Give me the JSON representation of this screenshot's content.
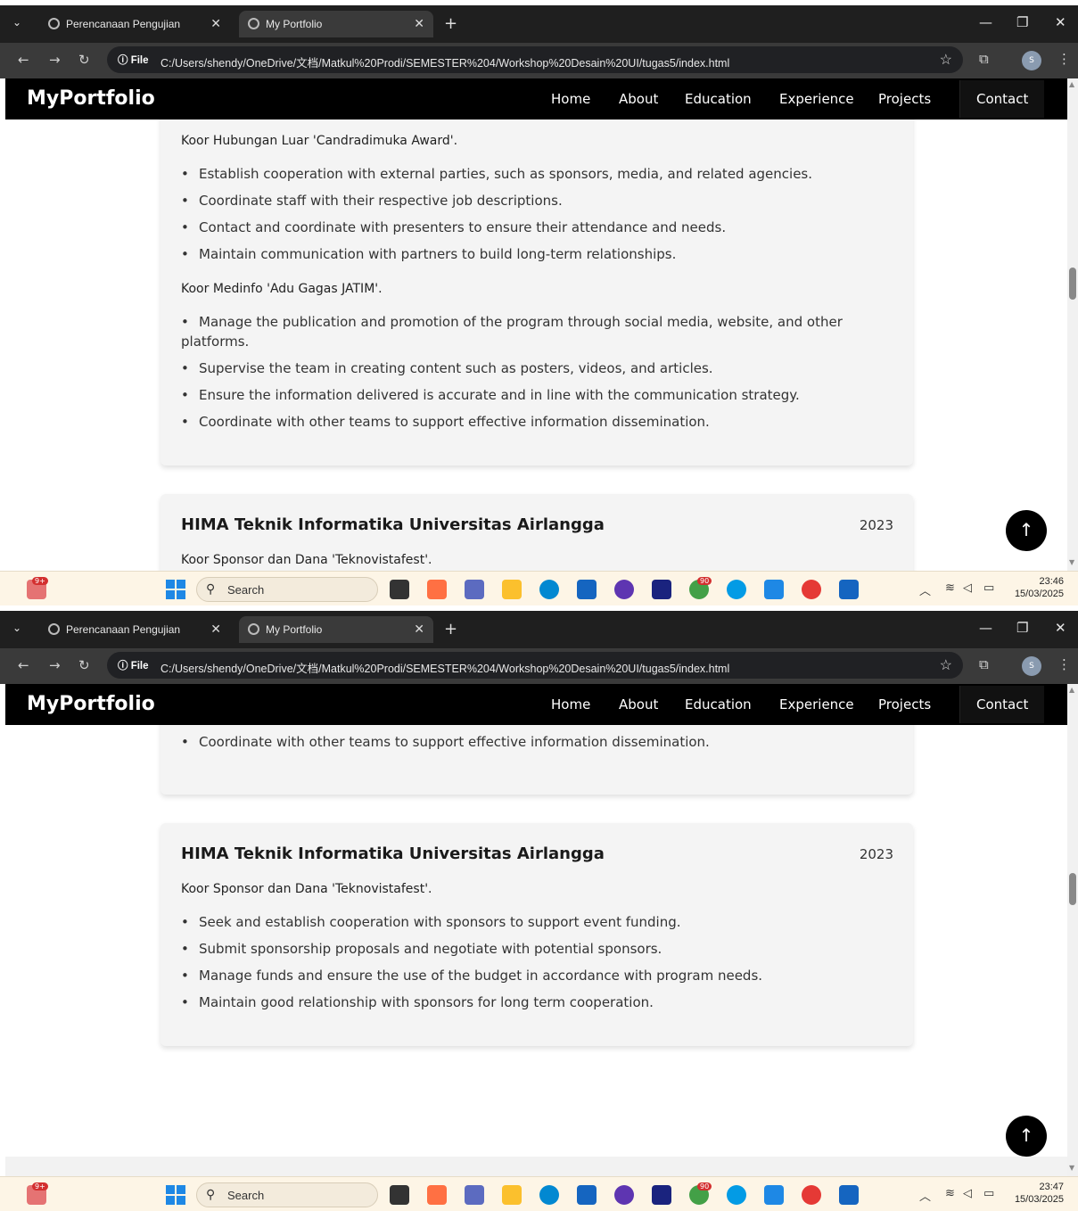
{
  "browser": {
    "tabs": [
      {
        "title": "Perencanaan Pengujian SouvStu"
      },
      {
        "title": "My Portfolio"
      }
    ],
    "file_chip": "ⓘ File",
    "url": "C:/Users/shendy/OneDrive/文档/Matkul%20Prodi/SEMESTER%204/Workshop%20Desain%20UI/tugas5/index.html"
  },
  "site": {
    "logo": "MyPortfolio",
    "nav": [
      "Home",
      "About",
      "Education",
      "Experience",
      "Projects",
      "Contact"
    ]
  },
  "experience": {
    "roles": [
      {
        "title": "Koor Hubungan Luar 'Candradimuka Award'.",
        "bullets": [
          "Establish cooperation with external parties, such as sponsors, media, and related agencies.",
          "Coordinate staff with their respective job descriptions.",
          "Contact and coordinate with presenters to ensure their attendance and needs.",
          "Maintain communication with partners to build long-term relationships."
        ]
      },
      {
        "title": "Koor Medinfo 'Adu Gagas JATIM'.",
        "bullets": [
          "Manage the publication and promotion of the program through social media, website, and other platforms.",
          "Supervise the team in creating content such as posters, videos, and articles.",
          "Ensure the information delivered is accurate and in line with the communication strategy.",
          "Coordinate with other teams to support effective information dissemination."
        ]
      }
    ],
    "hima": {
      "org": "HIMA Teknik Informatika Universitas Airlangga",
      "year": "2023",
      "role": "Koor Sponsor dan Dana 'Teknovistafest'.",
      "bullets": [
        "Seek and establish cooperation with sponsors to support event funding.",
        "Submit sponsorship proposals and negotiate with potential sponsors.",
        "Manage funds and ensure the use of the budget in accordance with program needs.",
        "Maintain good relationship with sponsors for long term cooperation."
      ]
    }
  },
  "taskbar": {
    "search": "Search",
    "notif_badge": "9+",
    "whatsapp_badge": "90",
    "times": [
      "23:46",
      "23:47"
    ],
    "date": "15/03/2025"
  }
}
